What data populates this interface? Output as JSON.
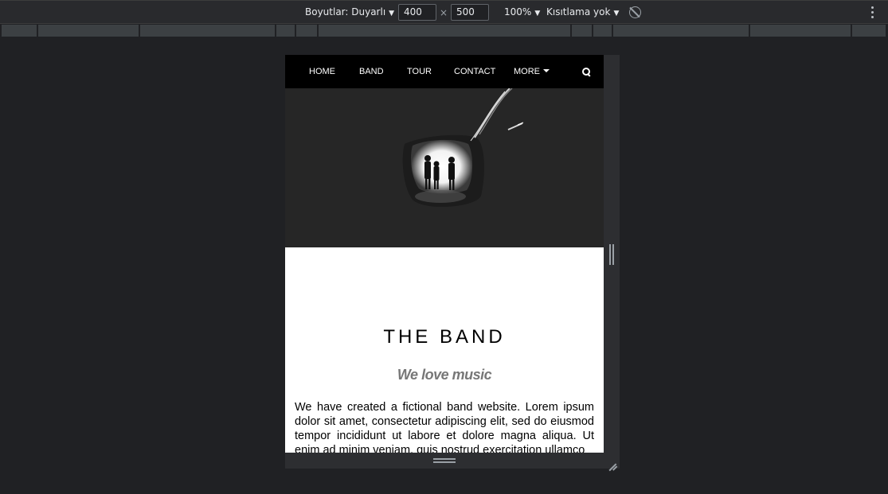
{
  "devtools": {
    "dimensions_label": "Boyutlar: Duyarlı",
    "width": "400",
    "height": "500",
    "times": "×",
    "zoom": "100%",
    "throttle": "Kısıtlama yok",
    "caret": "▼"
  },
  "nav": {
    "items": [
      {
        "label": "HOME"
      },
      {
        "label": "BAND"
      },
      {
        "label": "TOUR"
      },
      {
        "label": "CONTACT"
      },
      {
        "label": "MORE"
      }
    ]
  },
  "band": {
    "title": "THE BAND",
    "subtitle": "We love music",
    "body": "We have created a fictional band website. Lorem ipsum dolor sit amet, consectetur adipiscing elit, sed do eiusmod tempor incididunt ut labore et dolore magna aliqua. Ut enim ad minim veniam, quis nostrud exercitation ullamco"
  }
}
